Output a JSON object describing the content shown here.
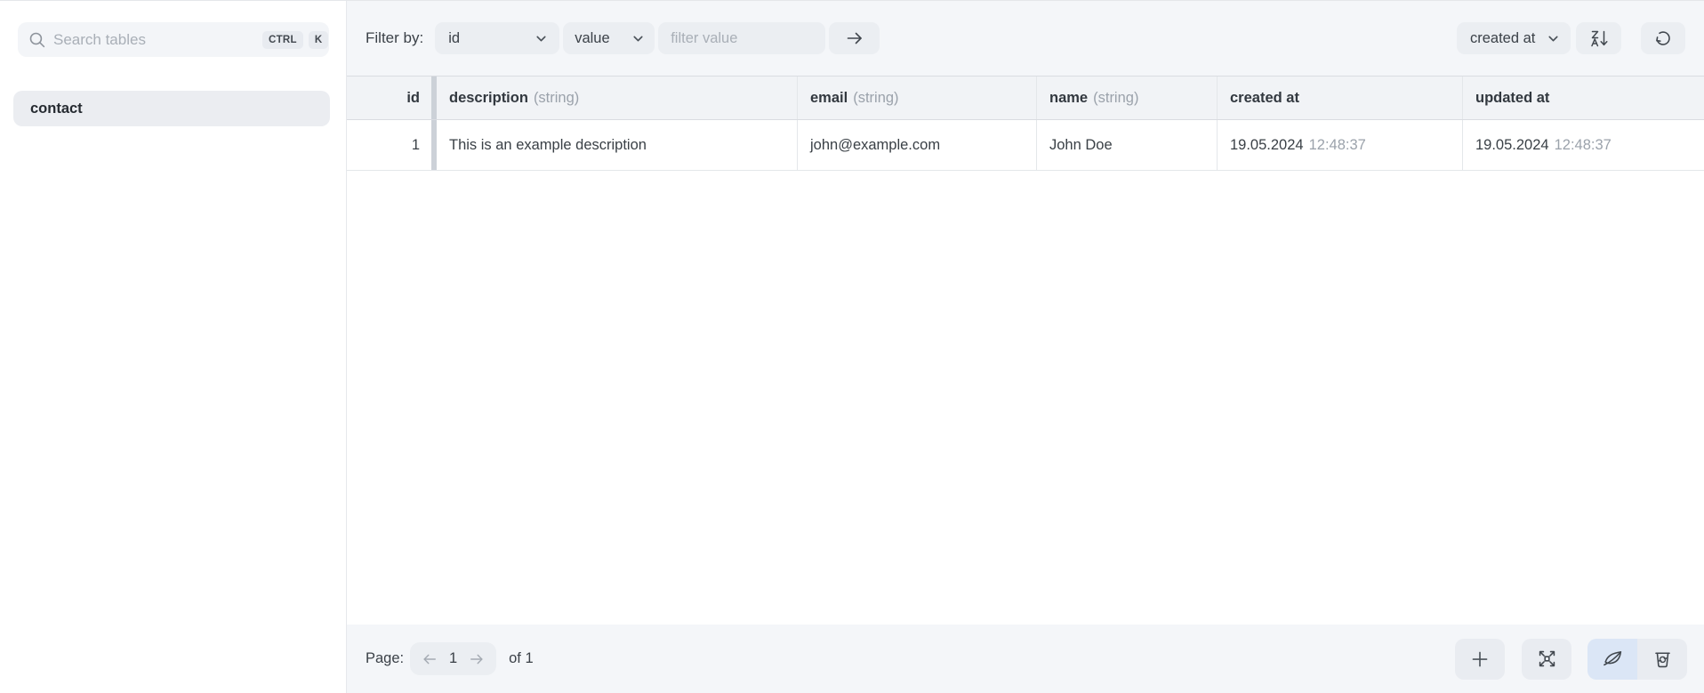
{
  "colors": {
    "panel_background": "#f4f6f9",
    "table_header_background": "#f1f3f6",
    "control_background": "#ebeef2",
    "active_button_accent": "#dbe6f6"
  },
  "icons": [
    "search-icon",
    "chevron-down-icon",
    "arrow-right-icon",
    "sort-za-icon",
    "refresh-icon",
    "arrow-left-icon",
    "plus-icon",
    "expand-icon",
    "leaf-icon",
    "trash-refresh-icon"
  ],
  "sidebar": {
    "search": {
      "placeholder": "Search tables",
      "shortcut_ctrl": "CTRL",
      "shortcut_k": "K"
    },
    "tables": [
      {
        "name": "contact",
        "selected": true
      }
    ]
  },
  "toolbar": {
    "filter_label": "Filter by:",
    "filter_column_selected": "id",
    "filter_operator_selected": "value",
    "filter_value_placeholder": "filter value",
    "sort_column_selected": "created at"
  },
  "table": {
    "columns": [
      {
        "label": "id",
        "type": ""
      },
      {
        "label": "description",
        "type": "(string)"
      },
      {
        "label": "email",
        "type": "(string)"
      },
      {
        "label": "name",
        "type": "(string)"
      },
      {
        "label": "created at",
        "type": ""
      },
      {
        "label": "updated at",
        "type": ""
      }
    ],
    "rows": [
      {
        "id": "1",
        "description": "This is an example description",
        "email": "john@example.com",
        "name": "John Doe",
        "created_at_date": "19.05.2024",
        "created_at_time": "12:48:37",
        "updated_at_date": "19.05.2024",
        "updated_at_time": "12:48:37"
      }
    ]
  },
  "footer": {
    "page_label": "Page:",
    "current_page": "1",
    "total_pages_label": "of 1"
  }
}
